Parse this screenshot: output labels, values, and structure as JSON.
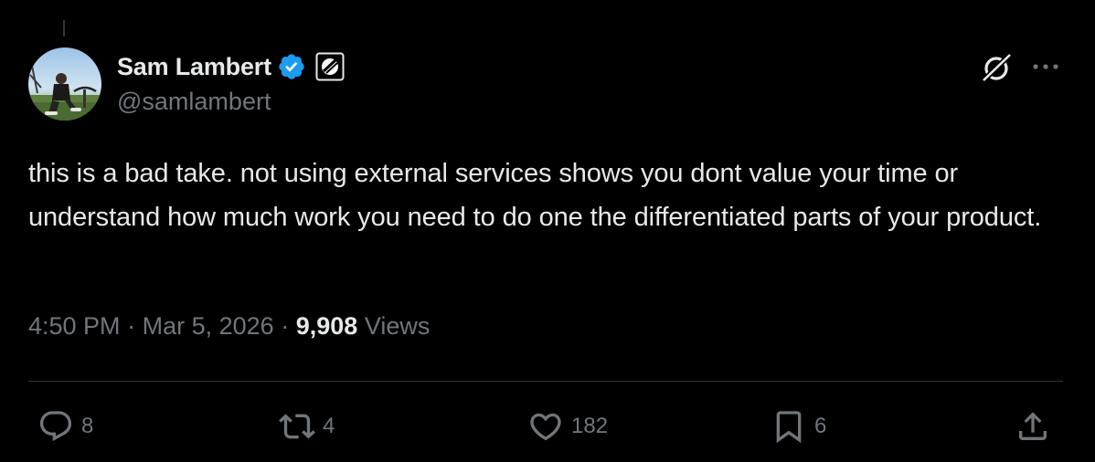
{
  "author": {
    "display_name": "Sam Lambert",
    "handle": "@samlambert",
    "verified": true
  },
  "tweet": {
    "text": "this is a bad take. not using external services shows you dont value your time or understand how much work you need to do one the differentiated parts of your product.",
    "time": "4:50 PM",
    "separator": "·",
    "date": "Mar 5, 2026",
    "views_count": "9,908",
    "views_label": "Views"
  },
  "actions": {
    "replies": "8",
    "reposts": "4",
    "likes": "182",
    "bookmarks": "6"
  },
  "colors": {
    "background": "#000000",
    "text_primary": "#e7e9ea",
    "text_secondary": "#71767b",
    "verified_blue": "#1d9bf0",
    "divider": "#2f3336"
  },
  "icons": {
    "verified": "verified-badge-icon",
    "affiliate": "affiliate-badge-icon",
    "grok": "grok-icon",
    "more": "more-icon",
    "reply": "reply-icon",
    "repost": "repost-icon",
    "like": "heart-icon",
    "bookmark": "bookmark-icon",
    "share": "share-icon"
  }
}
